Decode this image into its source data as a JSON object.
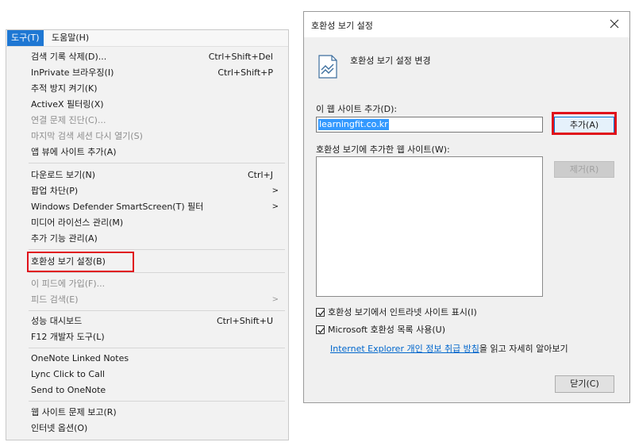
{
  "menu": {
    "menubar": {
      "tools": "도구(T)",
      "help": "도움말(H)"
    },
    "items": [
      {
        "label": "검색 기록 삭제(D)...",
        "shortcut": "Ctrl+Shift+Del"
      },
      {
        "label": "InPrivate 브라우징(I)",
        "shortcut": "Ctrl+Shift+P"
      },
      {
        "label": "추적 방지 켜기(K)"
      },
      {
        "label": "ActiveX 필터링(X)"
      },
      {
        "label": "연결 문제 진단(C)..."
      },
      {
        "label": "마지막 검색 세션 다시 열기(S)"
      },
      {
        "label": "앱 뷰에 사이트 추가(A)"
      },
      {
        "label": "다운로드 보기(N)",
        "shortcut": "Ctrl+J"
      },
      {
        "label": "팝업 차단(P)",
        "arrow": ">"
      },
      {
        "label": "Windows Defender SmartScreen(T) 필터",
        "arrow": ">"
      },
      {
        "label": "미디어 라이선스 관리(M)"
      },
      {
        "label": "추가 기능 관리(A)"
      },
      {
        "label": "호환성 보기 설정(B)"
      },
      {
        "label": "이 피드에 가입(F)..."
      },
      {
        "label": "피드 검색(E)",
        "arrow": ">"
      },
      {
        "label": "성능 대시보드",
        "shortcut": "Ctrl+Shift+U"
      },
      {
        "label": "F12 개발자 도구(L)"
      },
      {
        "label": "OneNote Linked Notes"
      },
      {
        "label": "Lync Click to Call"
      },
      {
        "label": "Send to OneNote"
      },
      {
        "label": "웹 사이트 문제 보고(R)"
      },
      {
        "label": "인터넷 옵션(O)"
      }
    ]
  },
  "dialog": {
    "title": "호환성 보기 설정",
    "header": "호환성 보기 설정 변경",
    "add_label": "이 웹 사이트 추가(D):",
    "site_value": "learningfit.co.kr",
    "add_button": "추가(A)",
    "list_label": "호환성 보기에 추가한 웹 사이트(W):",
    "remove_button": "제거(R)",
    "check_intranet": "호환성 보기에서 인트라넷 사이트 표시(I)",
    "check_ms_list": "Microsoft 호환성 목록 사용(U)",
    "link_text": "Internet Explorer 개인 정보 취급 방침",
    "link_suffix": "을 읽고 자세히 알아보기",
    "close_button": "닫기(C)"
  },
  "colors": {
    "highlight": "#e0121b",
    "menu_selected": "#1e77d3",
    "link": "#0066cc"
  },
  "icons": [
    "close-icon",
    "compatibility-page-icon",
    "check-icon",
    "chevron-right-icon"
  ]
}
